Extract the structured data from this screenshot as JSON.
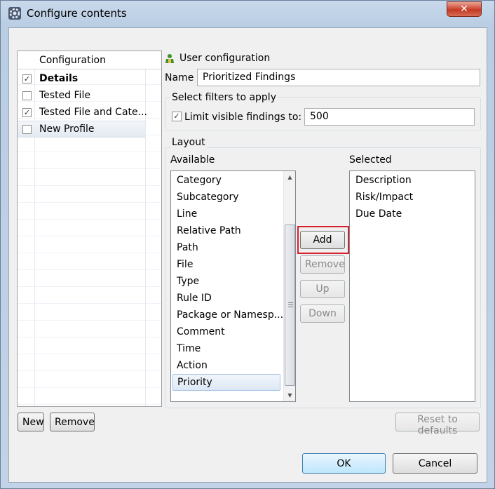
{
  "window": {
    "title": "Configure contents",
    "close_glyph": "✕"
  },
  "config_table": {
    "header": "Configuration",
    "rows": [
      {
        "label": "Details",
        "checked": true,
        "bold": true
      },
      {
        "label": "Tested File",
        "checked": false,
        "bold": false
      },
      {
        "label": "Tested File and Cate...",
        "checked": true,
        "bold": false
      },
      {
        "label": "New Profile",
        "checked": false,
        "bold": false,
        "selected": true
      }
    ],
    "check_glyph": "✓"
  },
  "left_buttons": {
    "new": "New",
    "remove": "Remove"
  },
  "user_config": {
    "heading": "User configuration",
    "icon": "user-icon",
    "name_label": "Name",
    "name_value": "Prioritized Findings"
  },
  "filters": {
    "group_label": "Select filters to apply",
    "limit_label": "Limit visible findings to:",
    "limit_checked": true,
    "limit_value": "500"
  },
  "layout": {
    "group_label": "Layout",
    "available_label": "Available",
    "selected_label": "Selected",
    "available_items": [
      "Category",
      "Subcategory",
      "Line",
      "Relative Path",
      "Path",
      "File",
      "Type",
      "Rule ID",
      "Package or Namesp...",
      "Comment",
      "Time",
      "Action",
      "Priority"
    ],
    "available_selected": "Priority",
    "selected_items": [
      "Description",
      "Risk/Impact",
      "Due Date"
    ],
    "buttons": {
      "add": "Add",
      "remove": "Remove",
      "up": "Up",
      "down": "Down"
    }
  },
  "footer": {
    "reset": "Reset to defaults",
    "ok": "OK",
    "cancel": "Cancel"
  },
  "colors": {
    "highlight": "#d6202d",
    "ok_accent": "#3c7fb1"
  }
}
